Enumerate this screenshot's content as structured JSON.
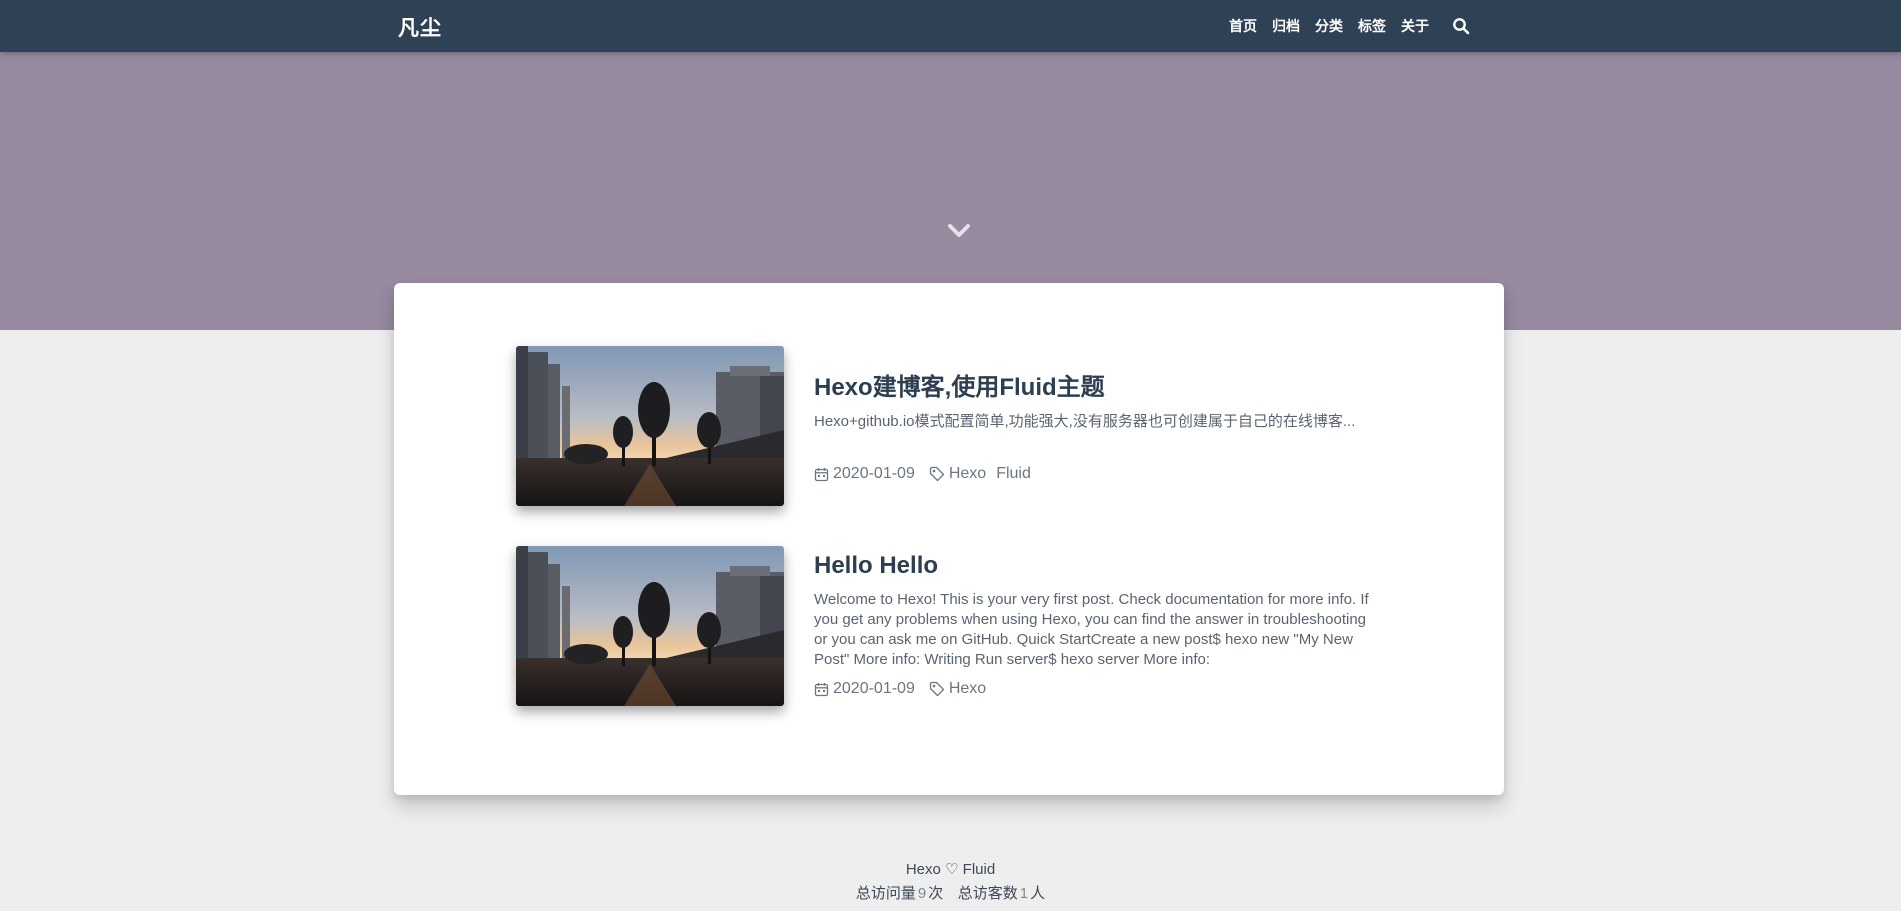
{
  "navbar": {
    "brand": "凡尘",
    "items": [
      {
        "label": "首页"
      },
      {
        "label": "归档"
      },
      {
        "label": "分类"
      },
      {
        "label": "标签"
      },
      {
        "label": "关于"
      }
    ],
    "bg_color": "#2f4154"
  },
  "banner": {
    "bg_color": "#978aa0",
    "scroll_icon": "chevron-down-icon"
  },
  "posts": [
    {
      "title": "Hexo建博客,使用Fluid主题",
      "excerpt": "Hexo+github.io模式配置简单,功能强大,没有服务器也可创建属于自己的在线博客...",
      "date": "2020-01-09",
      "tags": [
        "Hexo",
        "Fluid"
      ]
    },
    {
      "title": "Hello Hello",
      "excerpt": "Welcome to Hexo! This is your very first post. Check documentation for more info. If you get any problems when using Hexo, you can find the answer in troubleshooting or you can ask me on GitHub. Quick StartCreate a new post$ hexo new \"My New Post\" More info: Writing Run server$ hexo server More info:",
      "date": "2020-01-09",
      "tags": [
        "Hexo"
      ]
    }
  ],
  "footer": {
    "powered_left": "Hexo",
    "powered_right": "Fluid",
    "pv_label": "总访问量",
    "pv_count": "9",
    "pv_unit": "次",
    "uv_label": "总访客数",
    "uv_count": "1",
    "uv_unit": "人"
  }
}
